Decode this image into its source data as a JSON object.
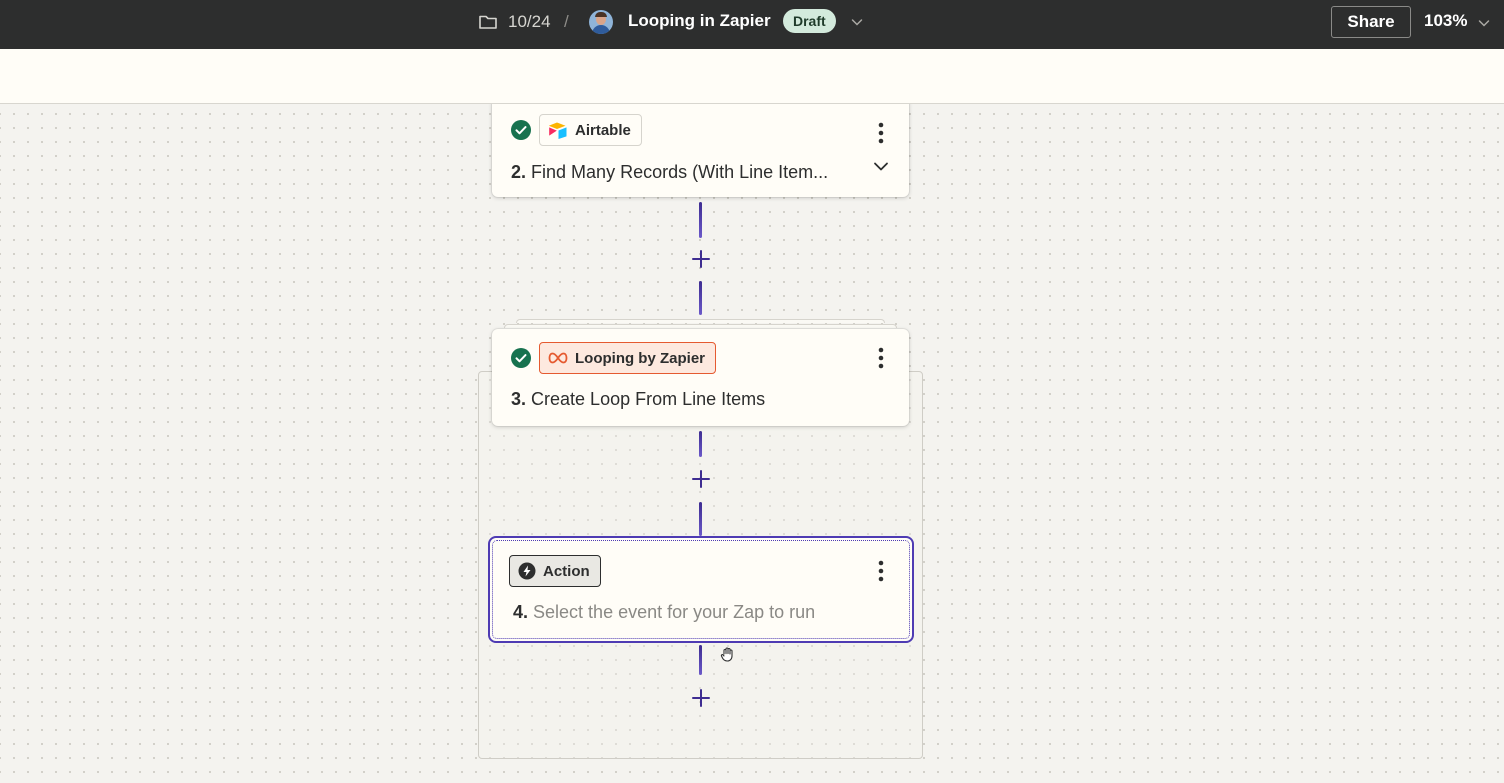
{
  "header": {
    "folder_count": "10/24",
    "separator": "/",
    "zap_title": "Looping in Zapier",
    "status_badge": "Draft",
    "share_label": "Share",
    "zoom_level": "103%"
  },
  "steps": [
    {
      "number": "2.",
      "app": "Airtable",
      "title": "Find Many Records (With Line Item...",
      "status": "complete"
    },
    {
      "number": "3.",
      "app": "Looping by Zapier",
      "title": "Create Loop From Line Items",
      "status": "complete"
    },
    {
      "number": "4.",
      "app": "Action",
      "title": "Select the event for your Zap to run",
      "status": "selected"
    }
  ],
  "icons": {
    "folder": "folder-icon",
    "check": "check-circle-icon",
    "more": "vertical-dots-icon",
    "chevron": "chevron-down-icon",
    "plus": "plus-icon",
    "loop": "infinity-loop-icon",
    "bolt": "lightning-bolt-icon",
    "cursor": "grab-hand-icon"
  },
  "colors": {
    "topbar": "#2d2e2e",
    "accent": "#4e3bb3",
    "success": "#17724f",
    "looping_brand": "#e55a30",
    "draft_badge": "#d3eadc"
  }
}
